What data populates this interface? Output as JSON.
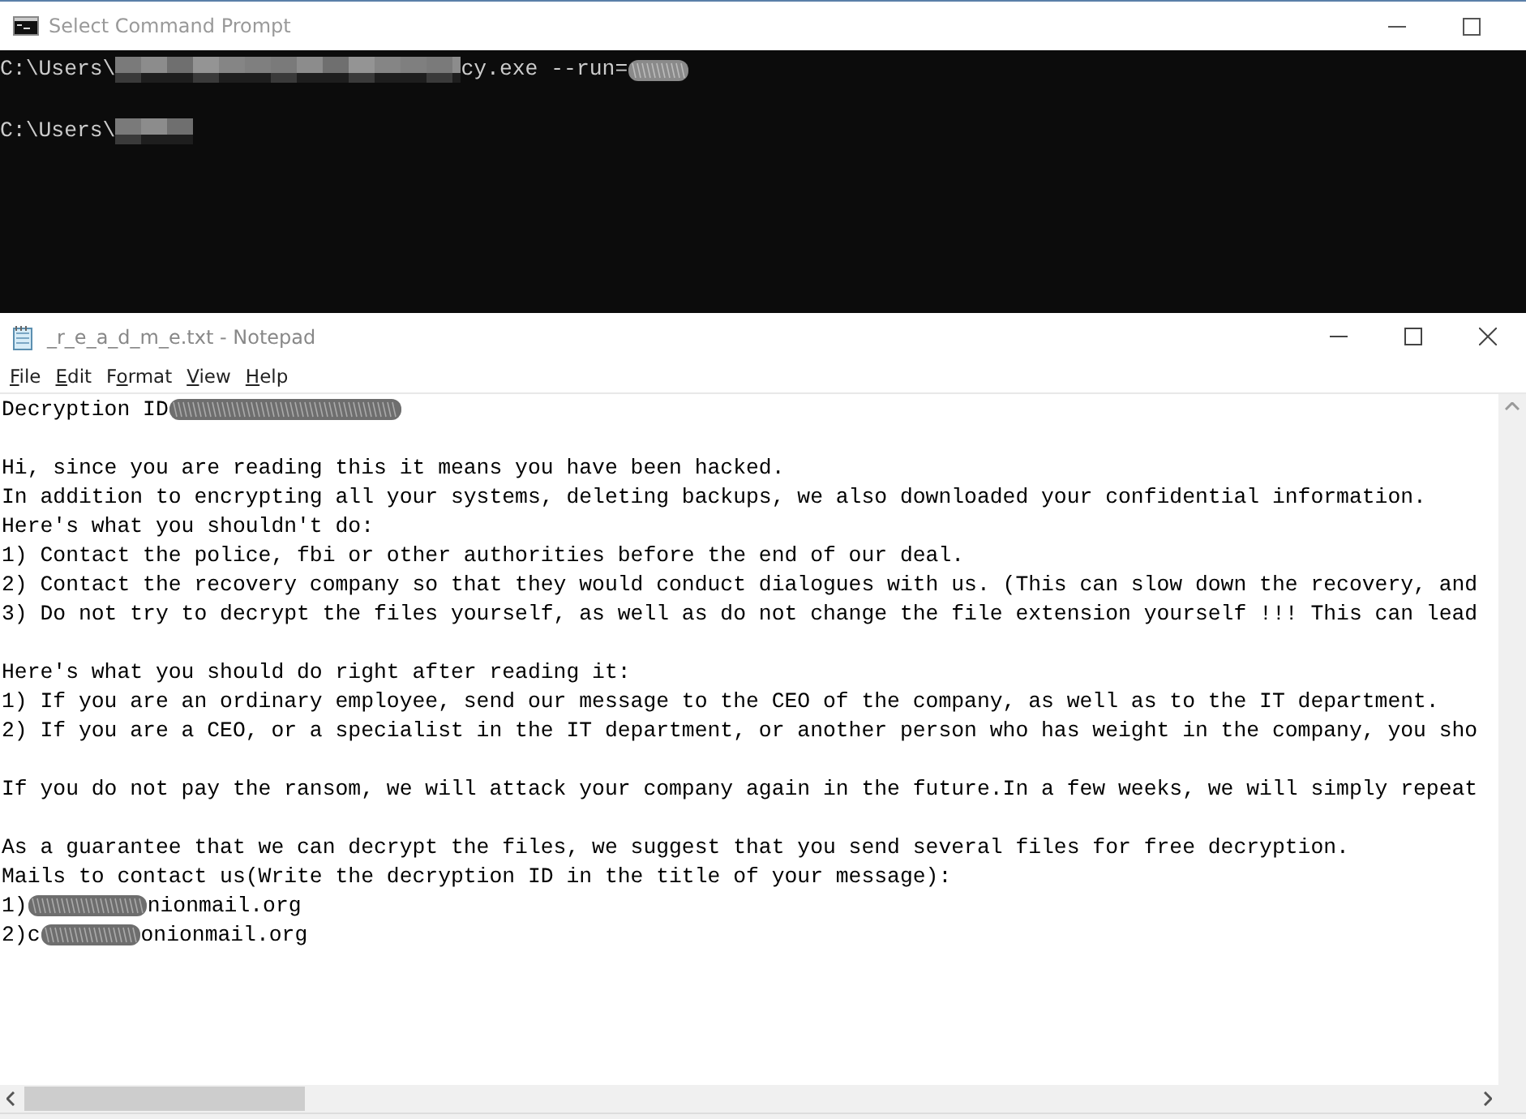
{
  "console_window": {
    "title": "Select Command Prompt",
    "lines": [
      {
        "kind": "text",
        "segments": [
          {
            "kind": "text",
            "text": "C:\\Users\\"
          },
          {
            "kind": "pixelated"
          },
          {
            "kind": "text",
            "text": "cy.exe --run="
          },
          {
            "kind": "scribble"
          }
        ]
      },
      {
        "kind": "blank"
      },
      {
        "kind": "text",
        "segments": [
          {
            "kind": "text",
            "text": "C:\\Users\\"
          },
          {
            "kind": "pixelated"
          }
        ]
      }
    ]
  },
  "notepad_window": {
    "title": "_r_e_a_d_m_e.txt - Notepad",
    "menu": [
      {
        "key": "F",
        "post": "ile"
      },
      {
        "key": "E",
        "post": "dit"
      },
      {
        "pre": "F",
        "key": "o",
        "post": "rmat"
      },
      {
        "key": "V",
        "post": "iew"
      },
      {
        "key": "H",
        "post": "elp"
      }
    ],
    "lines": [
      {
        "kind": "text",
        "segments": [
          {
            "kind": "text",
            "text": "Decryption ID"
          },
          {
            "kind": "scribble"
          }
        ]
      },
      {
        "kind": "blank"
      },
      {
        "kind": "text",
        "segments": [
          {
            "kind": "text",
            "text": "Hi, since you are reading this it means you have been hacked."
          }
        ]
      },
      {
        "kind": "text",
        "segments": [
          {
            "kind": "text",
            "text": "In addition to encrypting all your systems, deleting backups, we also downloaded your confidential information."
          }
        ]
      },
      {
        "kind": "text",
        "segments": [
          {
            "kind": "text",
            "text": "Here's what you shouldn't do:"
          }
        ]
      },
      {
        "kind": "text",
        "segments": [
          {
            "kind": "text",
            "text": "1) Contact the police, fbi or other authorities before the end of our deal."
          }
        ]
      },
      {
        "kind": "text",
        "segments": [
          {
            "kind": "text",
            "text": "2) Contact the recovery company so that they would conduct dialogues with us. (This can slow down the recovery, and"
          }
        ]
      },
      {
        "kind": "text",
        "segments": [
          {
            "kind": "text",
            "text": "3) Do not try to decrypt the files yourself, as well as do not change the file extension yourself !!! This can lead"
          }
        ]
      },
      {
        "kind": "blank"
      },
      {
        "kind": "text",
        "segments": [
          {
            "kind": "text",
            "text": "Here's what you should do right after reading it:"
          }
        ]
      },
      {
        "kind": "text",
        "segments": [
          {
            "kind": "text",
            "text": "1) If you are an ordinary employee, send our message to the CEO of the company, as well as to the IT department."
          }
        ]
      },
      {
        "kind": "text",
        "segments": [
          {
            "kind": "text",
            "text": "2) If you are a CEO, or a specialist in the IT department, or another person who has weight in the company, you sho"
          }
        ]
      },
      {
        "kind": "blank"
      },
      {
        "kind": "text",
        "segments": [
          {
            "kind": "text",
            "text": "If you do not pay the ransom, we will attack your company again in the future.In a few weeks, we will simply repeat"
          }
        ]
      },
      {
        "kind": "blank"
      },
      {
        "kind": "text",
        "segments": [
          {
            "kind": "text",
            "text": "As a guarantee that we can decrypt the files, we suggest that you send several files for free decryption."
          }
        ]
      },
      {
        "kind": "text",
        "segments": [
          {
            "kind": "text",
            "text": "Mails to contact us(Write the decryption ID in the title of your message):"
          }
        ]
      },
      {
        "kind": "text",
        "segments": [
          {
            "kind": "text",
            "text": "1)"
          },
          {
            "kind": "scribble"
          },
          {
            "kind": "text",
            "text": "nionmail.org"
          }
        ]
      },
      {
        "kind": "text",
        "segments": [
          {
            "kind": "text",
            "text": "2)c"
          },
          {
            "kind": "scribble"
          },
          {
            "kind": "text",
            "text": "onionmail.org"
          }
        ]
      }
    ]
  }
}
